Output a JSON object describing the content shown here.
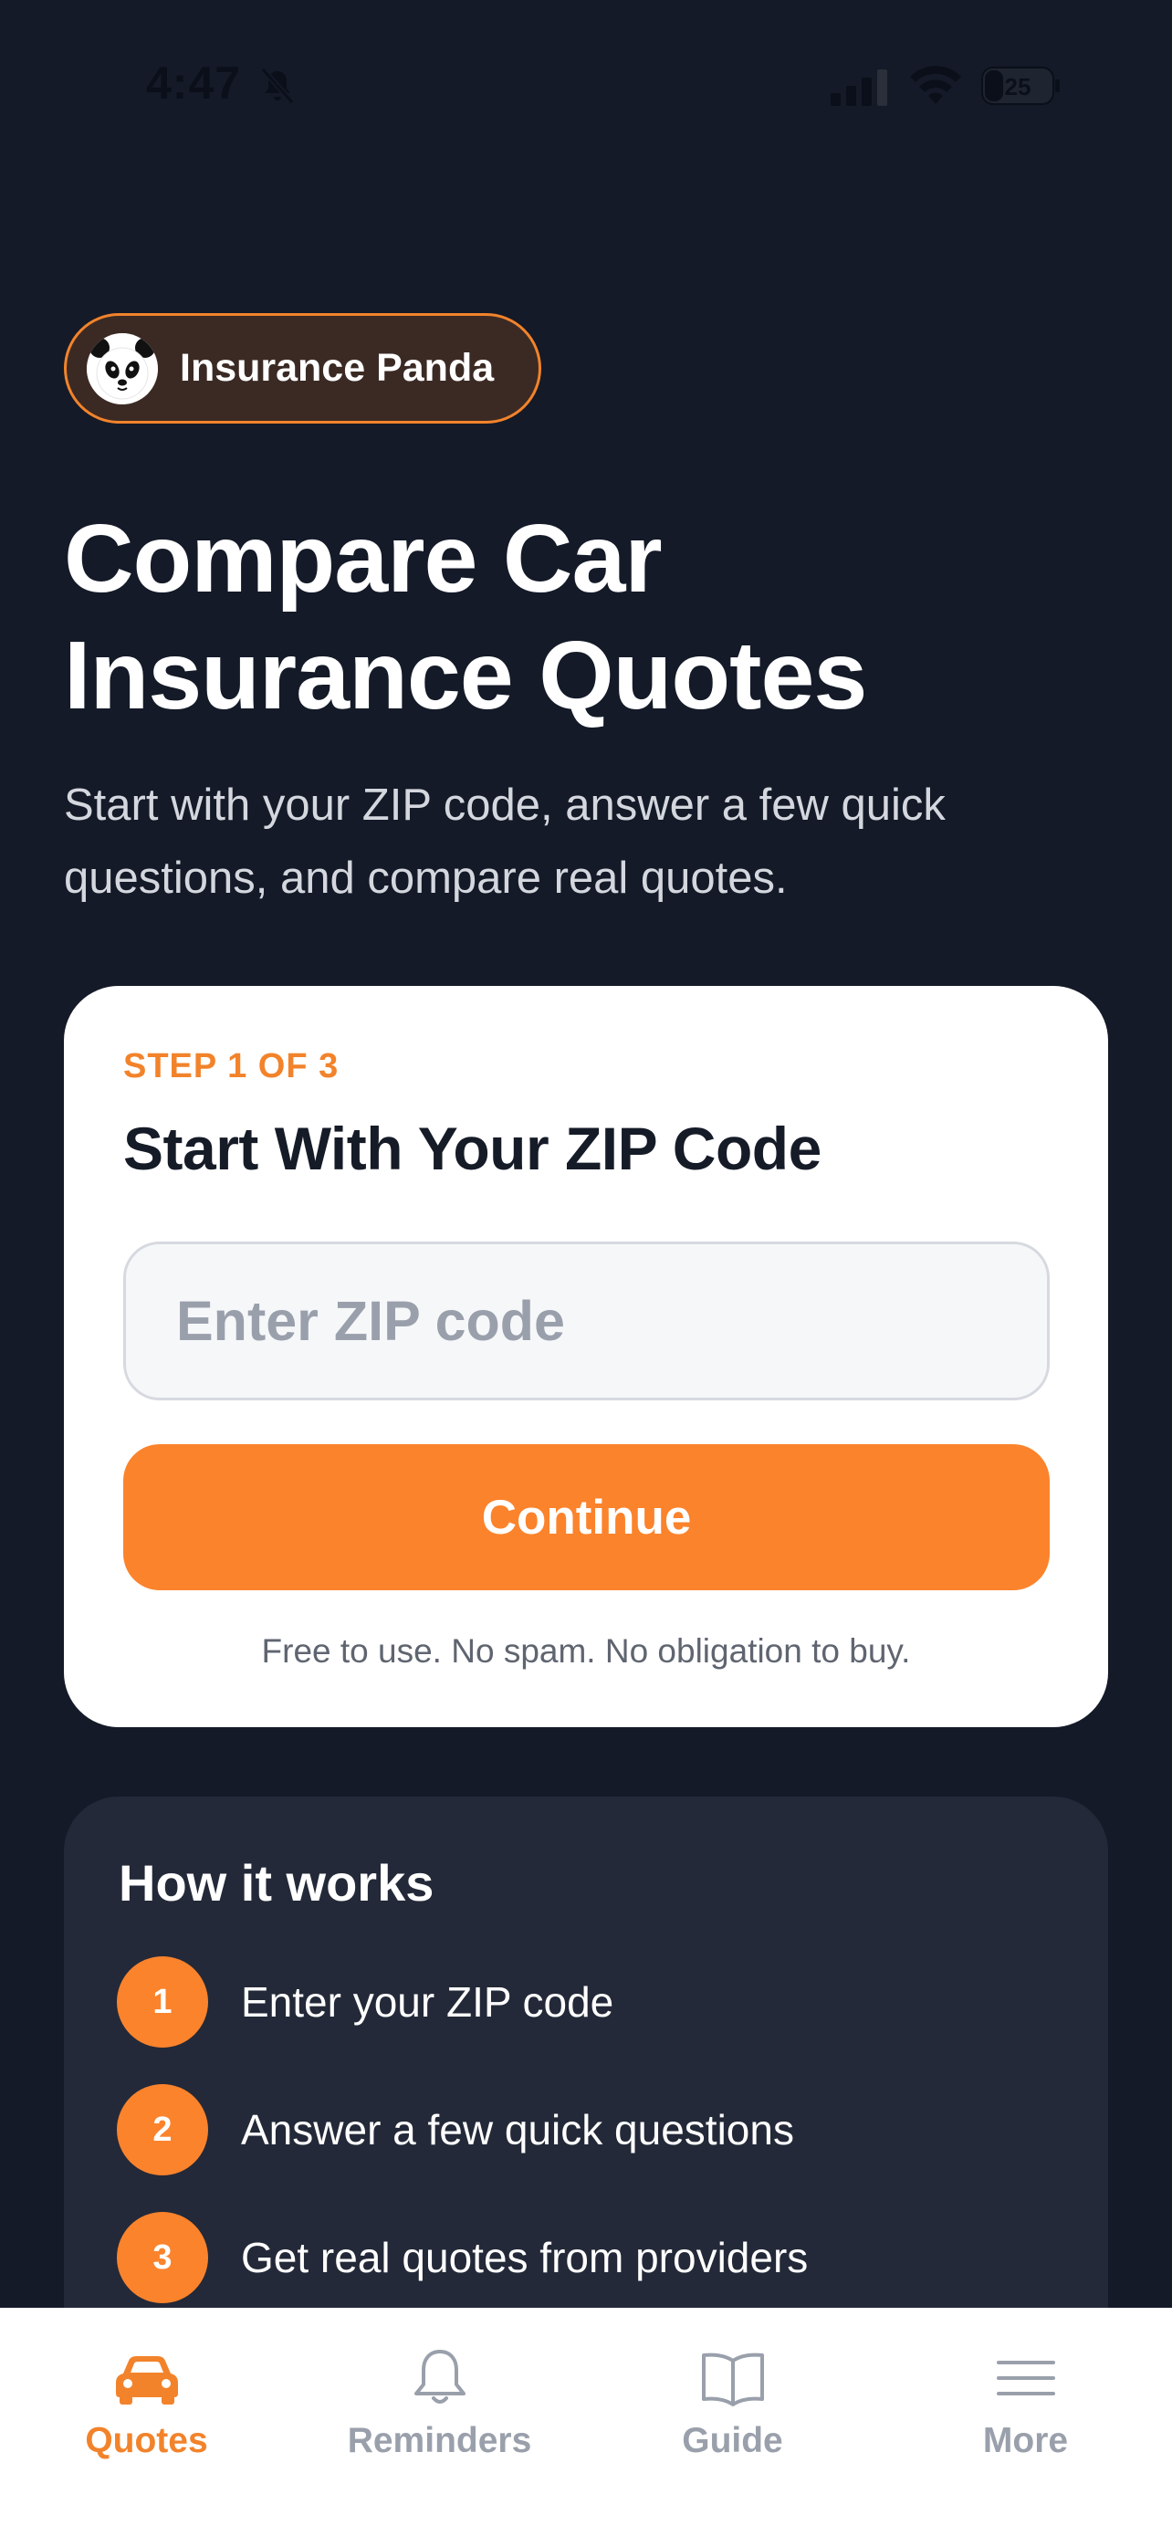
{
  "status_bar": {
    "time": "4:47",
    "battery": "25"
  },
  "brand": {
    "name": "Insurance Panda"
  },
  "hero": {
    "title": "Compare Car Insurance Quotes",
    "subtitle": "Start with your ZIP code, answer a few quick questions, and compare real quotes."
  },
  "form": {
    "step_label": "STEP 1 OF 3",
    "title": "Start With Your ZIP Code",
    "zip_placeholder": "Enter ZIP code",
    "zip_value": "",
    "continue_label": "Continue",
    "fine_print": "Free to use. No spam. No obligation to buy."
  },
  "how_it_works": {
    "title": "How it works",
    "steps": [
      {
        "number": "1",
        "text": "Enter your ZIP code"
      },
      {
        "number": "2",
        "text": "Answer a few quick questions"
      },
      {
        "number": "3",
        "text": "Get real quotes from providers"
      }
    ]
  },
  "tab_bar": {
    "tabs": [
      {
        "label": "Quotes",
        "icon": "car-icon",
        "active": true
      },
      {
        "label": "Reminders",
        "icon": "bell-icon",
        "active": false
      },
      {
        "label": "Guide",
        "icon": "book-icon",
        "active": false
      },
      {
        "label": "More",
        "icon": "menu-icon",
        "active": false
      }
    ]
  },
  "colors": {
    "background": "#141a28",
    "accent": "#fb832c",
    "card": "#ffffff",
    "secondary_card": "#232938",
    "inactive_tab": "#9aa0ab"
  }
}
